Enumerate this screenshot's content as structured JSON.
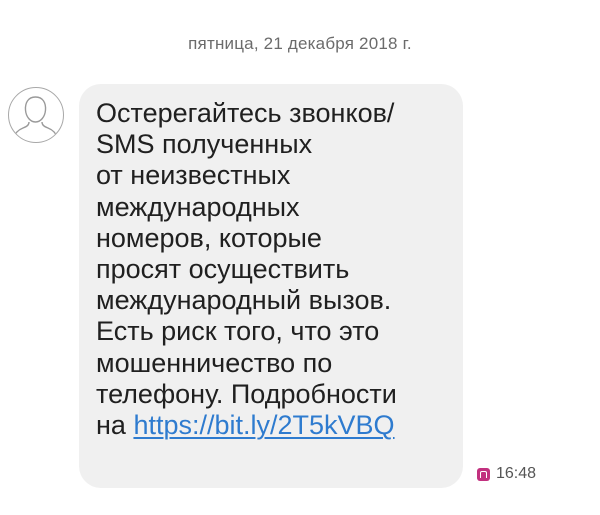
{
  "conversation": {
    "date_header": "пятница, 21 декабря 2018 г."
  },
  "message": {
    "sender_avatar": "person-silhouette-icon",
    "text": "Остерегайтесь звонков/\nSMS полученных\nот неизвестных\nмеждународных\nномеров, которые\nпросят осуществить\nмеждународный вызов.\nЕсть риск того, что это\nмошенничество по\nтелефону. Подробности\nна ",
    "link_text": "https://bit.ly/2T5kVBQ",
    "time": "16:48",
    "sim_icon": "sim-card-icon"
  },
  "colors": {
    "bubble_background": "#f0f0f0",
    "link": "#2e7bcf",
    "sim_icon": "#c2307f",
    "date_text": "#6b6b6b"
  }
}
